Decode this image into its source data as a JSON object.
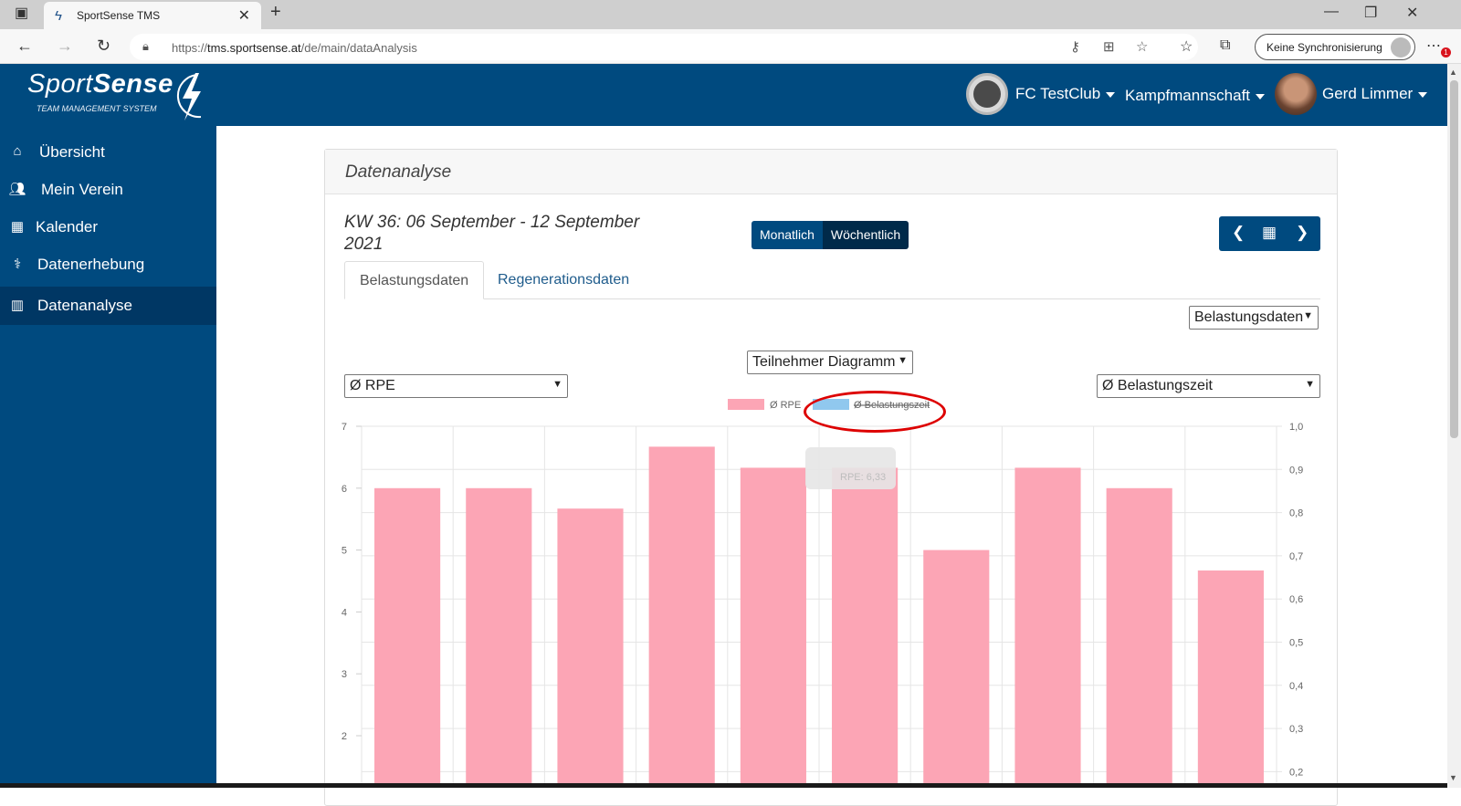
{
  "browser": {
    "tab_title": "SportSense TMS",
    "url_prefix": "https://",
    "url_host": "tms.sportsense.at",
    "url_path": "/de/main/dataAnalysis",
    "sync_label": "Keine Synchronisierung",
    "notification_count": "1"
  },
  "header": {
    "logo_text_light": "Sport",
    "logo_text_bold": "Sense",
    "logo_subtitle": "TEAM MANAGEMENT SYSTEM",
    "club": "FC TestClub",
    "team": "Kampfmannschaft",
    "user": "Gerd Limmer"
  },
  "sidebar": {
    "items": [
      {
        "label": "Übersicht",
        "icon": "home-icon"
      },
      {
        "label": "Mein Verein",
        "icon": "users-icon"
      },
      {
        "label": "Kalender",
        "icon": "calendar-icon"
      },
      {
        "label": "Datenerhebung",
        "icon": "stethoscope-icon"
      },
      {
        "label": "Datenanalyse",
        "icon": "bar-chart-icon",
        "active": true
      }
    ]
  },
  "card": {
    "title": "Datenanalyse",
    "period_line1": "KW 36: 06 September - 12 September",
    "period_line2": "2021",
    "toggle": {
      "monthly": "Monatlich",
      "weekly": "Wöchentlich",
      "selected": "Wöchentlich"
    },
    "tabs": [
      "Belastungsdaten",
      "Regenerationsdaten"
    ],
    "active_tab": "Belastungsdaten",
    "data_select": "Belastungsdaten",
    "diagram_select": "Teilnehmer Diagramm",
    "left_metric_select": "Ø RPE",
    "right_metric_select": "Ø Belastungszeit"
  },
  "chart_data": {
    "type": "bar",
    "series": [
      {
        "name": "Ø RPE",
        "color": "#fca5b5",
        "values": [
          6,
          6,
          5.67,
          6.67,
          6.33,
          6.33,
          5,
          6.33,
          6,
          4.67
        ],
        "axis": "left"
      },
      {
        "name": "Ø Belastungszeit",
        "color": "#90c8ee",
        "hidden": true,
        "axis": "right"
      }
    ],
    "y_left": {
      "min": 1,
      "max": 7,
      "ticks": [
        "2",
        "3",
        "4",
        "5",
        "6",
        "7"
      ]
    },
    "y_right": {
      "min": 0,
      "max": 1.0,
      "ticks": [
        "0,2",
        "0,3",
        "0,4",
        "0,5",
        "0,6",
        "0,7",
        "0,8",
        "0,9",
        "1,0"
      ]
    },
    "grid": true,
    "legend_position": "top",
    "tooltip_text": "RPE: 6,33"
  }
}
